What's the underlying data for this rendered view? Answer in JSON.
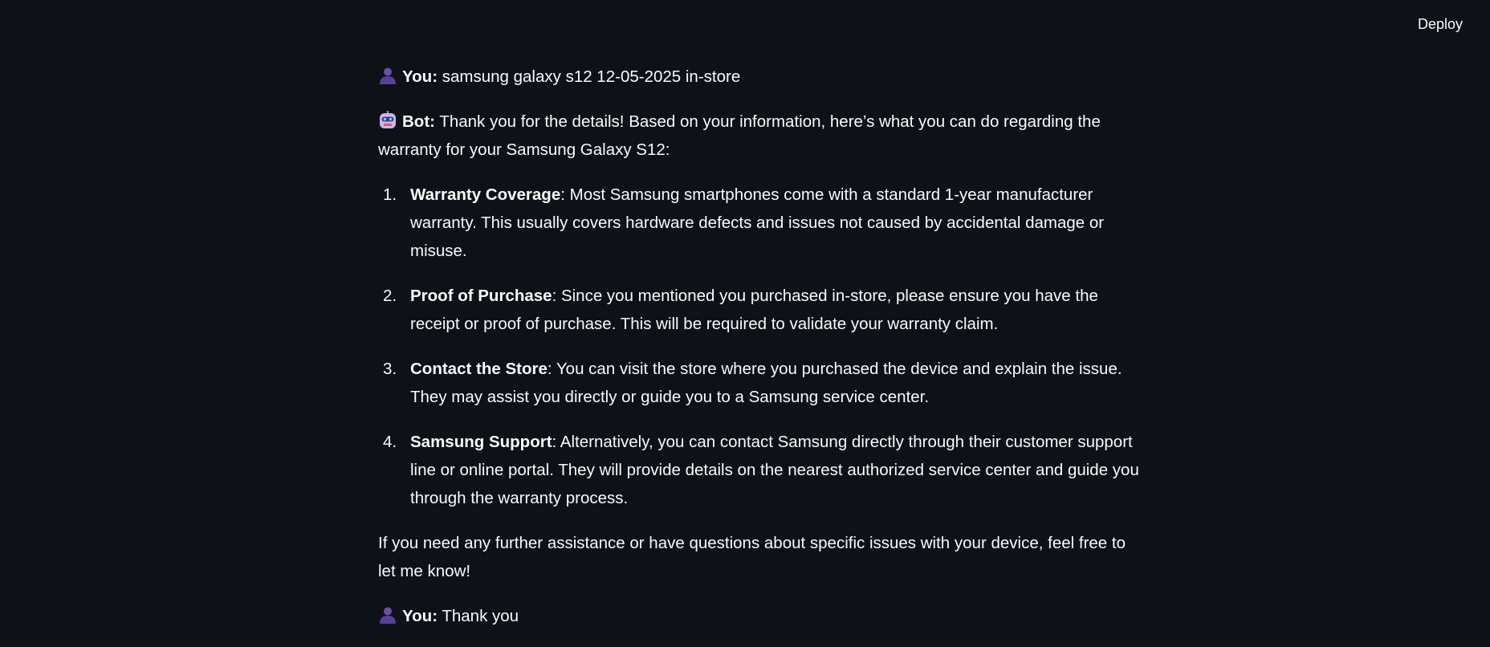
{
  "header": {
    "deploy_label": "Deploy"
  },
  "chat": {
    "messages": [
      {
        "speaker_label": "You:",
        "icon": "user-icon",
        "text": "samsung galaxy s12 12-05-2025 in-store"
      },
      {
        "speaker_label": "Bot:",
        "icon": "robot-icon",
        "intro": "Thank you for the details! Based on your information, here’s what you can do regarding the warranty for your Samsung Galaxy S12:",
        "points": [
          {
            "number": "1.",
            "title": "Warranty Coverage",
            "text": ": Most Samsung smartphones come with a standard 1-year manufacturer warranty. This usually covers hardware defects and issues not caused by accidental damage or misuse."
          },
          {
            "number": "2.",
            "title": "Proof of Purchase",
            "text": ": Since you mentioned you purchased in-store, please ensure you have the receipt or proof of purchase. This will be required to validate your warranty claim."
          },
          {
            "number": "3.",
            "title": "Contact the Store",
            "text": ": You can visit the store where you purchased the device and explain the issue. They may assist you directly or guide you to a Samsung service center."
          },
          {
            "number": "4.",
            "title": "Samsung Support",
            "text": ": Alternatively, you can contact Samsung directly through their customer support line or online portal. They will provide details on the nearest authorized service center and guide you through the warranty process."
          }
        ],
        "outro": "If you need any further assistance or have questions about specific issues with your device, feel free to let me know!"
      },
      {
        "speaker_label": "You:",
        "icon": "user-icon",
        "text": "Thank you"
      }
    ]
  },
  "colors": {
    "background": "#0e1117",
    "text": "#fafafa",
    "user_icon": "#6b4fa8",
    "robot_icon": "#c9b8e8"
  }
}
